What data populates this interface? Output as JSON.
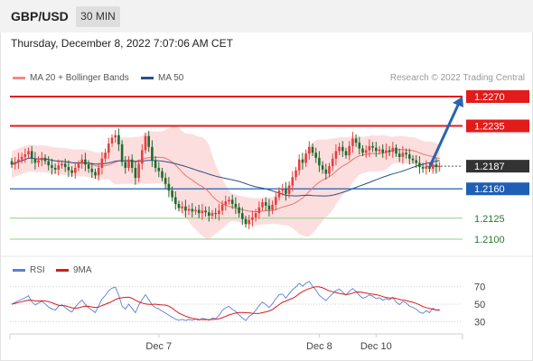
{
  "header": {
    "symbol": "GBP/USD",
    "timeframe": "30 MIN",
    "datetime": "Thursday, December 8, 2022 7:07:06 AM CET",
    "credit": "Research © 2022 Trading Central"
  },
  "colors": {
    "resistance": "#e31b1b",
    "support": "#1f5fb5",
    "target": "#8fcf8f",
    "bull": "#e34040",
    "bear": "#1f6b2f",
    "band": "#fbd6d6",
    "ma20": "#e87575",
    "ma50": "#2b4f8c",
    "arrow": "#2a63b0",
    "rsi": "#5a7fd6",
    "rsi_ma": "#d81b1b",
    "current_label": "#333333"
  },
  "chart_data": [
    {
      "type": "candlestick",
      "legend": [
        "MA 20 + Bollinger Bands",
        "MA 50"
      ],
      "y_ticks": [
        1.21,
        1.2125,
        1.216,
        1.2187,
        1.2235,
        1.227
      ],
      "y_labels": [
        "1.2270",
        "1.2235",
        "1.2187",
        "1.2160",
        "1.2125",
        "1.2100"
      ],
      "current_price": "1.2187",
      "levels": [
        {
          "label": "1.2270",
          "value": 1.227,
          "kind": "resistance"
        },
        {
          "label": "1.2235",
          "value": 1.2235,
          "kind": "resistance"
        },
        {
          "label": "1.2160",
          "value": 1.216,
          "kind": "support"
        },
        {
          "label": "1.2125",
          "value": 1.2125,
          "kind": "target"
        },
        {
          "label": "1.2100",
          "value": 1.21,
          "kind": "target"
        }
      ],
      "forecast_arrow": {
        "from": 1.2187,
        "to": 1.227
      },
      "close": [
        1.2189,
        1.2192,
        1.2195,
        1.2198,
        1.2201,
        1.2205,
        1.2196,
        1.2191,
        1.2194,
        1.2197,
        1.2193,
        1.2188,
        1.2185,
        1.2183,
        1.2188,
        1.219,
        1.2186,
        1.2182,
        1.2179,
        1.2185,
        1.219,
        1.2195,
        1.2189,
        1.2184,
        1.218,
        1.2176,
        1.2185,
        1.2196,
        1.2203,
        1.2214,
        1.2221,
        1.2224,
        1.2213,
        1.2192,
        1.2185,
        1.2195,
        1.2185,
        1.2173,
        1.219,
        1.2206,
        1.2223,
        1.221,
        1.2194,
        1.2185,
        1.2181,
        1.2173,
        1.2166,
        1.2158,
        1.215,
        1.2142,
        1.2137,
        1.2139,
        1.2134,
        1.2136,
        1.2133,
        1.2135,
        1.2131,
        1.2134,
        1.2132,
        1.2128,
        1.2131,
        1.213,
        1.2134,
        1.2141,
        1.2145,
        1.2147,
        1.2142,
        1.2138,
        1.2131,
        1.2124,
        1.2118,
        1.2123,
        1.2126,
        1.2131,
        1.2138,
        1.2144,
        1.214,
        1.2135,
        1.2141,
        1.215,
        1.2158,
        1.216,
        1.2154,
        1.2164,
        1.2174,
        1.2182,
        1.2195,
        1.2191,
        1.2202,
        1.221,
        1.2203,
        1.2197,
        1.2188,
        1.2183,
        1.2178,
        1.2187,
        1.2196,
        1.2205,
        1.221,
        1.2205,
        1.22,
        1.2211,
        1.222,
        1.2215,
        1.2208,
        1.2203,
        1.2206,
        1.2211,
        1.2209,
        1.2205,
        1.2207,
        1.2203,
        1.2206,
        1.2204,
        1.2209,
        1.2202,
        1.2198,
        1.2203,
        1.2201,
        1.2196,
        1.2194,
        1.2191,
        1.2186,
        1.2184,
        1.2187,
        1.2184,
        1.2189,
        1.2186,
        1.2187
      ],
      "x_labels": [
        {
          "label": "Dec 7",
          "index": 44
        },
        {
          "label": "Dec 8",
          "index": 92
        },
        {
          "label": "Dec 10",
          "index": 109
        }
      ]
    },
    {
      "type": "line",
      "legend": [
        "RSI",
        "9MA"
      ],
      "y_ticks": [
        30,
        50,
        70
      ],
      "ylim": [
        20,
        80
      ]
    }
  ]
}
